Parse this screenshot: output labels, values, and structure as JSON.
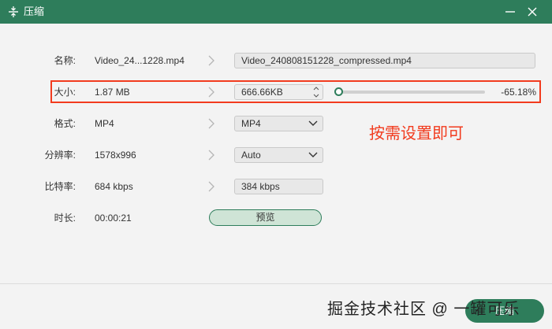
{
  "window": {
    "title": "压缩",
    "app_icon": "compress-icon",
    "controls": [
      "minimize-icon",
      "close-icon"
    ],
    "accent_color": "#2e7d5b"
  },
  "rows": {
    "name": {
      "label": "名称:",
      "source": "Video_24...1228.mp4",
      "target": "Video_240808151228_compressed.mp4"
    },
    "size": {
      "label": "大小:",
      "source": "1.87 MB",
      "target": "666.66KB",
      "reduction": "-65.18%",
      "slider_fraction": 0.0
    },
    "format": {
      "label": "格式:",
      "source": "MP4",
      "target": "MP4"
    },
    "resolution": {
      "label": "分辨率:",
      "source": "1578x996",
      "target": "Auto"
    },
    "bitrate": {
      "label": "比特率:",
      "source": "684 kbps",
      "target": "384 kbps"
    },
    "duration": {
      "label": "时长:",
      "source": "00:00:21"
    }
  },
  "preview_label": "预览",
  "annotation": {
    "text": "按需设置即可",
    "color": "#f23b1e"
  },
  "footer": {
    "compress_label": "压缩",
    "watermark": "掘金技术社区 @ 一罐可乐"
  }
}
